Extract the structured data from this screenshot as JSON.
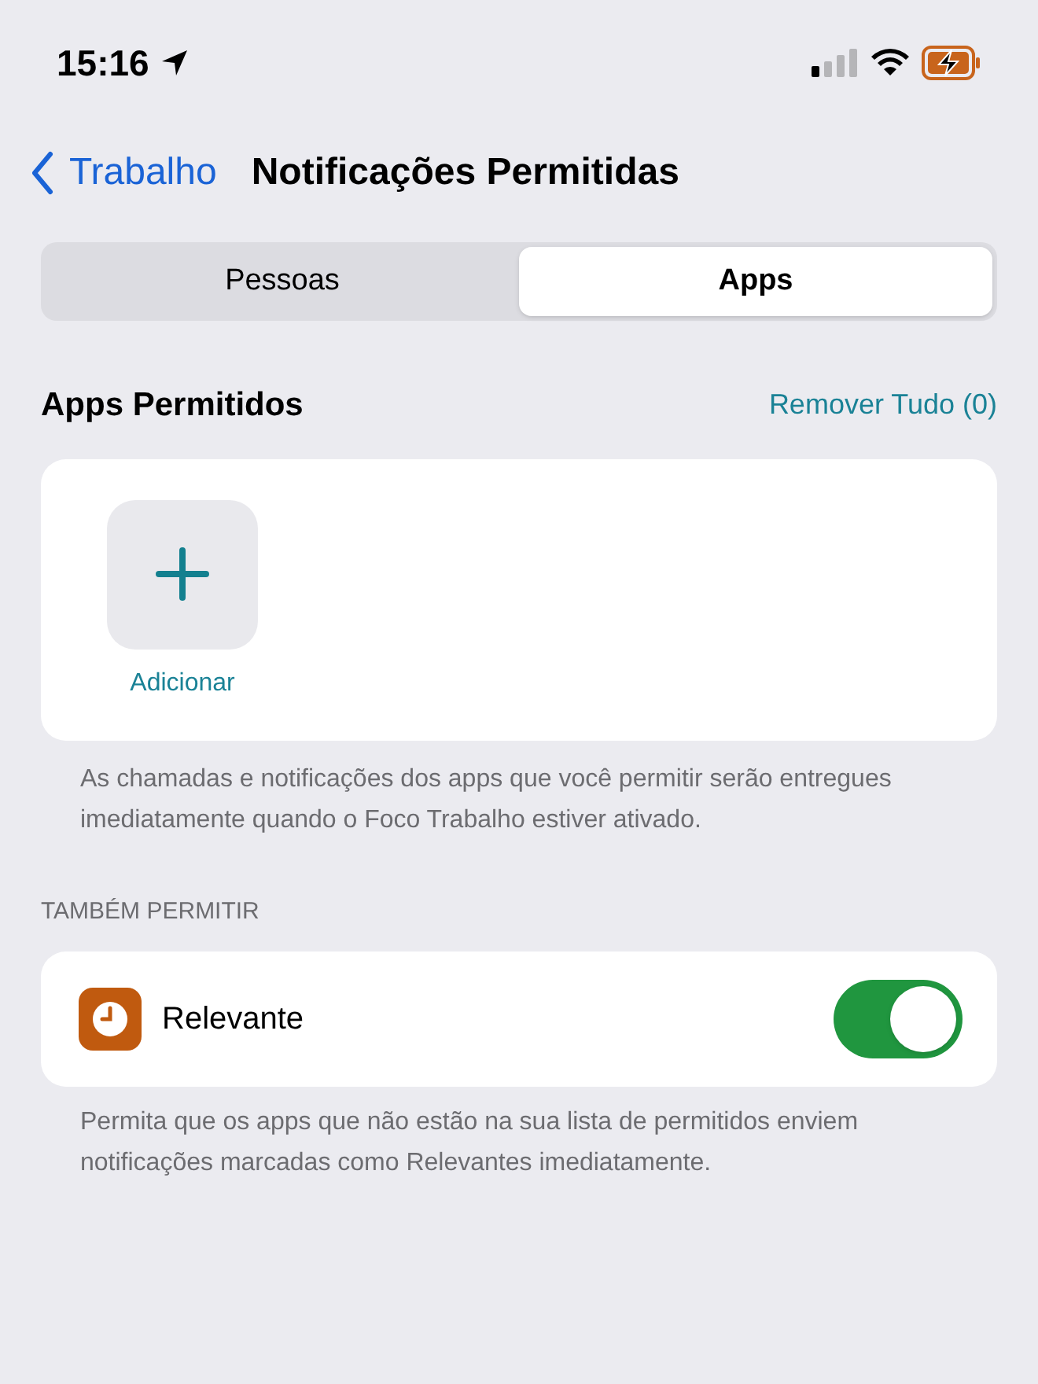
{
  "status_bar": {
    "time": "15:16"
  },
  "nav": {
    "back": "Trabalho",
    "title": "Notificações Permitidas"
  },
  "tabs": [
    {
      "label": "Pessoas",
      "selected": false
    },
    {
      "label": "Apps",
      "selected": true
    }
  ],
  "apps_section": {
    "title": "Apps Permitidos",
    "action": "Remover Tudo (0)",
    "add_label": "Adicionar",
    "footer": "As chamadas e notificações dos apps que você permitir serão entregues imediatamente quando o Foco Trabalho estiver ativado."
  },
  "also_allow": {
    "header": "TAMBÉM PERMITIR",
    "rows": [
      {
        "label": "Relevante",
        "on": true
      }
    ],
    "footer": "Permita que os apps que não estão na sua lista de permitidos enviem notificações marcadas como Relevantes imediatamente."
  }
}
